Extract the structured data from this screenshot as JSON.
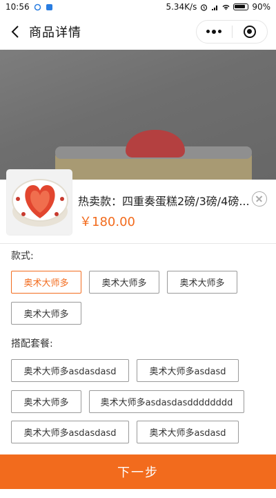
{
  "status_bar": {
    "time": "10:56",
    "network_speed": "5.34K/s",
    "battery": "90%"
  },
  "nav": {
    "title": "商品详情"
  },
  "product": {
    "title": "热卖款：四重奏蛋糕2磅/3磅/4磅...",
    "price": "￥180.00"
  },
  "options": {
    "style_label": "款式:",
    "style_items": [
      {
        "label": "奥术大师多",
        "selected": true
      },
      {
        "label": "奥术大师多",
        "selected": false
      },
      {
        "label": "奥术大师多",
        "selected": false
      },
      {
        "label": "奥术大师多",
        "selected": false
      }
    ],
    "package_label": "搭配套餐:",
    "package_items": [
      {
        "label": "奥术大师多asdasdasd"
      },
      {
        "label": "奥术大师多asdasd"
      },
      {
        "label": "奥术大师多"
      },
      {
        "label": "奥术大师多asdasdasdddddddd"
      },
      {
        "label": "奥术大师多asdasdasd"
      },
      {
        "label": "奥术大师多asdasd"
      }
    ]
  },
  "footer": {
    "next_label": "下一步"
  },
  "colors": {
    "accent": "#f26b1d",
    "overlay": "#6e6e6e"
  }
}
